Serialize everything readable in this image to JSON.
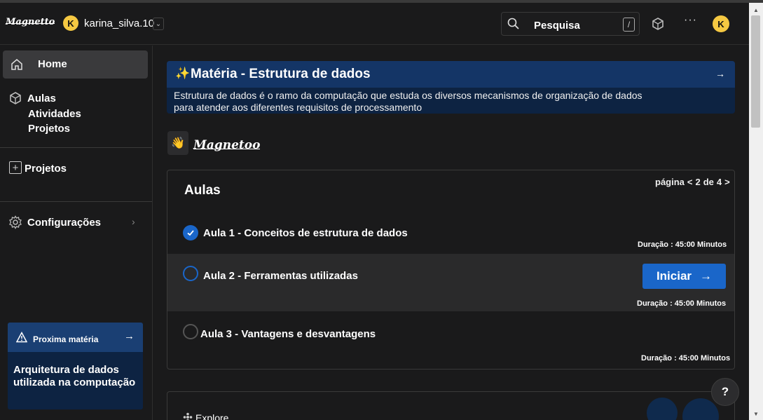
{
  "header": {
    "logo_text": "Magnetto",
    "user_initial": "K",
    "username": "karina_silva.10",
    "user_dropdown_glyph": "⌄",
    "search_placeholder": "Pesquisa",
    "search_shortcut": "/",
    "more_glyph": "···",
    "profile_initial": "K"
  },
  "sidebar": {
    "home_label": "Home",
    "aulas_label": "Aulas",
    "atividades_label": "Atividades",
    "projetos_sub_label": "Projetos",
    "projetos_label": "Projetos",
    "config_label": "Configurações",
    "next_subject": {
      "label": "Proxima matéria",
      "title": "Arquitetura de dados utilizada na computação"
    }
  },
  "banner": {
    "title": "Matéria - Estrutura de dados",
    "description": "Estrutura de dados é o ramo da computação que estuda os diversos mecanismos de organização de dados para atender aos diferentes requisitos de processamento"
  },
  "brand": {
    "name": "Magnetoo"
  },
  "lessons": {
    "title": "Aulas",
    "pager": {
      "prefix": "página",
      "current": "2",
      "of": "de",
      "total": "4"
    },
    "items": [
      {
        "title": "Aula 1 - Conceitos de estrutura de dados",
        "duration": "Duração : 45:00 Minutos",
        "status": "completed"
      },
      {
        "title": "Aula 2 - Ferramentas utilizadas",
        "duration": "Duração : 45:00 Minutos",
        "status": "current"
      },
      {
        "title": "Aula 3 - Vantagens e desvantagens",
        "duration": "Duração : 45:00 Minutos",
        "status": "pending"
      }
    ],
    "start_button": "Iniciar"
  },
  "explore": {
    "label": "Explore"
  },
  "help_label": "?",
  "colors": {
    "background": "#1a1a1b",
    "accent_blue": "#1a66c9",
    "banner_head": "#143566",
    "banner_body": "#0d2342",
    "avatar_yellow": "#f5c842"
  }
}
